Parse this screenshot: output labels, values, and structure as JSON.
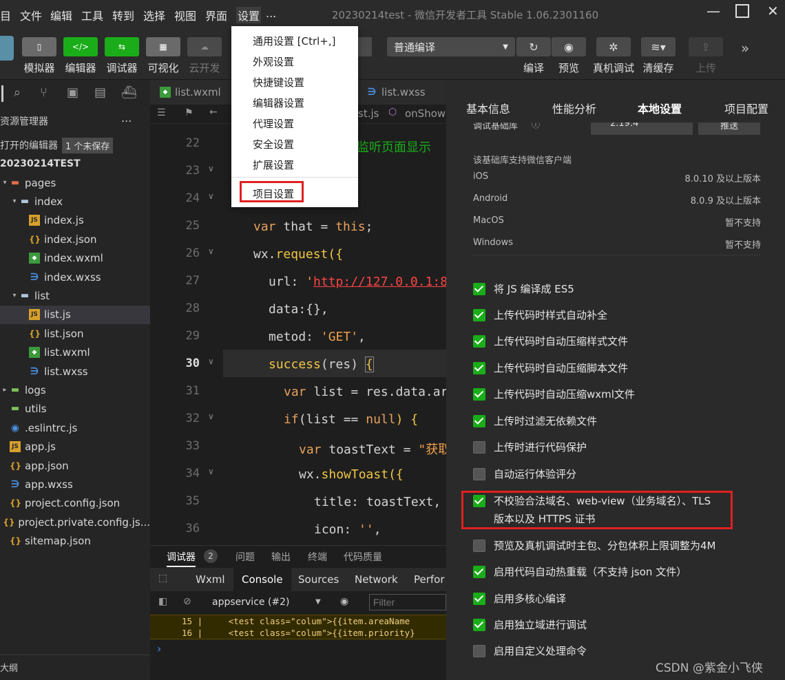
{
  "menubar": {
    "items": [
      "目",
      "文件",
      "编辑",
      "工具",
      "转到",
      "选择",
      "视图",
      "界面",
      "设置",
      "..."
    ],
    "window_title": "20230214test - 微信开发者工具 Stable 1.06.2301160"
  },
  "toolbar": {
    "buttons": [
      "模拟器",
      "编辑器",
      "调试器",
      "可视化",
      "云开发"
    ],
    "compile_mode": "普通编译",
    "actions": [
      "编译",
      "预览",
      "真机调试",
      "清缓存",
      "上传"
    ]
  },
  "sidebar": {
    "title": "资源管理器",
    "more": "...",
    "open_editors": "打开的编辑器",
    "unsaved_badge": "1 个未保存",
    "project": "20230214TEST",
    "tree": [
      {
        "label": "pages",
        "icon": "folder-o",
        "caret": "▾",
        "indent": 0
      },
      {
        "label": "index",
        "icon": "folder",
        "caret": "▾",
        "indent": 1
      },
      {
        "label": "index.js",
        "icon": "js",
        "caret": "",
        "indent": 2
      },
      {
        "label": "index.json",
        "icon": "json",
        "caret": "",
        "indent": 2
      },
      {
        "label": "index.wxml",
        "icon": "wxml",
        "caret": "",
        "indent": 2
      },
      {
        "label": "index.wxss",
        "icon": "wxss",
        "caret": "",
        "indent": 2
      },
      {
        "label": "list",
        "icon": "folder",
        "caret": "▾",
        "indent": 1
      },
      {
        "label": "list.js",
        "icon": "js",
        "caret": "",
        "indent": 2
      },
      {
        "label": "list.json",
        "icon": "json",
        "caret": "",
        "indent": 2
      },
      {
        "label": "list.wxml",
        "icon": "wxml",
        "caret": "",
        "indent": 2
      },
      {
        "label": "list.wxss",
        "icon": "wxss",
        "caret": "",
        "indent": 2
      },
      {
        "label": "logs",
        "icon": "folder-g",
        "caret": "▸",
        "indent": 0
      },
      {
        "label": "utils",
        "icon": "folder-g",
        "caret": "",
        "indent": 0
      },
      {
        "label": ".eslintrc.js",
        "icon": "eslint",
        "caret": "",
        "indent": 0
      },
      {
        "label": "app.js",
        "icon": "js",
        "caret": "",
        "indent": 0
      },
      {
        "label": "app.json",
        "icon": "json",
        "caret": "",
        "indent": 0
      },
      {
        "label": "app.wxss",
        "icon": "wxss",
        "caret": "",
        "indent": 0
      },
      {
        "label": "project.config.json",
        "icon": "json",
        "caret": "",
        "indent": 0
      },
      {
        "label": "project.private.config.js...",
        "icon": "json",
        "caret": "",
        "indent": 0
      },
      {
        "label": "sitemap.json",
        "icon": "json",
        "caret": "",
        "indent": 0
      }
    ],
    "outline": "大纲"
  },
  "editor": {
    "tabs": [
      "list.wxml",
      "list.wxss"
    ],
    "breadcrumb_file": "st.js",
    "breadcrumb_fn": "onShow",
    "comment_fragment": "监听页面显示",
    "line_numbers": [
      "22",
      "23",
      "24",
      "25",
      "26",
      "27",
      "28",
      "29",
      "30",
      "31",
      "32",
      "33",
      "34",
      "35",
      "36"
    ],
    "code": {
      "l25": [
        "var ",
        "that = ",
        "this",
        ";"
      ],
      "l26": [
        "wx.",
        "request",
        "({"
      ],
      "l27": [
        "url: ",
        "'",
        "http://127.0.0.1:8"
      ],
      "l28": "data:{},",
      "l29": [
        "metod: ",
        "'GET'",
        ","
      ],
      "l30": [
        "success",
        "(res) ",
        "{"
      ],
      "l31": [
        "var ",
        "list = res.data.ar"
      ],
      "l32": [
        "if",
        "(list == ",
        "null",
        ") {"
      ],
      "l33": [
        "var ",
        "toastText = ",
        "\"获取"
      ],
      "l34": [
        "wx.",
        "showToast",
        "({"
      ],
      "l35": "title: toastText,",
      "l36": [
        "icon: ",
        "''",
        ","
      ]
    }
  },
  "panel": {
    "tabs": [
      "调试器",
      "问题",
      "输出",
      "终端",
      "代码质量"
    ],
    "badge": "2",
    "devtools_tabs": [
      "Wxml",
      "Console",
      "Sources",
      "Network",
      "Perfor"
    ],
    "context": "appservice (#2)",
    "filter_placeholder": "Filter",
    "console_lines": [
      {
        "n": "15",
        "text": "<test class=\"colum\">{{item.areaName"
      },
      {
        "n": "16",
        "text": "<test class=\"colum\">{{item.priority}"
      }
    ],
    "prompt": "›"
  },
  "dropdown": {
    "items": [
      "通用设置  [Ctrl+,]",
      "外观设置",
      "快捷键设置",
      "编辑器设置",
      "代理设置",
      "安全设置",
      "扩展设置",
      "项目设置"
    ],
    "highlighted_index": 7
  },
  "settings": {
    "tabs": [
      "基本信息",
      "性能分析",
      "本地设置",
      "项目配置"
    ],
    "active_tab": "本地设置",
    "base_lib_label": "调试基础库",
    "base_lib_version": "2.19.4",
    "push_label": "推送",
    "support_title": "该基础库支持微信客户端",
    "support_rows": [
      {
        "os": "iOS",
        "val": "8.0.10 及以上版本"
      },
      {
        "os": "Android",
        "val": "8.0.9 及以上版本"
      },
      {
        "os": "MacOS",
        "val": "暂不支持"
      },
      {
        "os": "Windows",
        "val": "暂不支持"
      }
    ],
    "options": [
      {
        "label": "将 JS 编译成 ES5",
        "checked": true
      },
      {
        "label": "上传代码时样式自动补全",
        "checked": true
      },
      {
        "label": "上传代码时自动压缩样式文件",
        "checked": true
      },
      {
        "label": "上传代码时自动压缩脚本文件",
        "checked": true
      },
      {
        "label": "上传代码时自动压缩wxml文件",
        "checked": true
      },
      {
        "label": "上传时过滤无依赖文件",
        "checked": true
      },
      {
        "label": "上传时进行代码保护",
        "checked": false
      },
      {
        "label": "自动运行体验评分",
        "checked": false
      },
      {
        "label": "不校验合法域名、web-view（业务域名）、TLS",
        "label2": "版本以及 HTTPS 证书",
        "checked": true
      },
      {
        "label": "预览及真机调试时主包、分包体积上限调整为4M",
        "checked": false
      },
      {
        "label": "启用代码自动热重载（不支持 json 文件）",
        "checked": true
      },
      {
        "label": "启用多核心编译",
        "checked": true
      },
      {
        "label": "启用独立域进行调试",
        "checked": true
      },
      {
        "label": "启用自定义处理命令",
        "checked": false
      }
    ],
    "highlight_color": "#e02020"
  },
  "watermark": "CSDN @紫金小飞侠"
}
